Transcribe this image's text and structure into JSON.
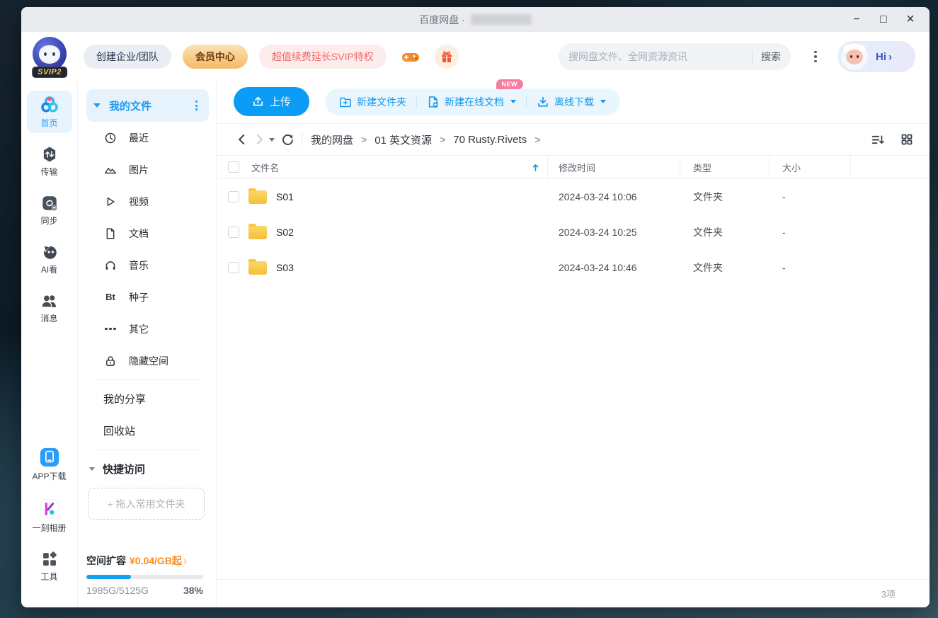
{
  "titlebar": {
    "title": "百度网盘 ·",
    "minimize": "−",
    "maximize": "□",
    "close": "×"
  },
  "header": {
    "logo_badge": "SVIP2",
    "create_team_label": "创建企业/团队",
    "member_center_label": "会员中心",
    "svip_promo_label": "超值续费延长SVIP特权",
    "search_placeholder": "搜网盘文件、全网资源资讯",
    "search_button_label": "搜索",
    "greeting": "Hi",
    "greeting_chevron": "›"
  },
  "rail": {
    "items": [
      {
        "label": "首页",
        "active": true
      },
      {
        "label": "传输",
        "active": false
      },
      {
        "label": "同步",
        "active": false
      },
      {
        "label": "AI看",
        "active": false
      },
      {
        "label": "消息",
        "active": false
      }
    ],
    "bottom_items": [
      {
        "label": "APP下载"
      },
      {
        "label": "一刻相册"
      },
      {
        "label": "工具"
      }
    ]
  },
  "sidebar": {
    "my_files_label": "我的文件",
    "items": [
      {
        "label": "最近"
      },
      {
        "label": "图片"
      },
      {
        "label": "视频"
      },
      {
        "label": "文档"
      },
      {
        "label": "音乐"
      },
      {
        "label": "种子",
        "icon_text": "Bt"
      },
      {
        "label": "其它"
      },
      {
        "label": "隐藏空间"
      }
    ],
    "my_share_label": "我的分享",
    "recycle_label": "回收站",
    "quick_access_label": "快捷访问",
    "drop_zone_hint": "+ 拖入常用文件夹",
    "expand": {
      "label": "空间扩容",
      "price": "¥0.04/GB起",
      "arrow": "›",
      "usage": "1985G/5125G",
      "percent_label": "38%",
      "percent_value": 38
    }
  },
  "toolbar": {
    "upload_label": "上传",
    "new_folder_label": "新建文件夹",
    "new_doc_label": "新建在线文档",
    "new_badge": "NEW",
    "offline_download_label": "离线下载"
  },
  "breadcrumb": {
    "items": [
      "我的网盘",
      "01 英文资源",
      "70 Rusty.Rivets"
    ]
  },
  "table": {
    "headers": {
      "name": "文件名",
      "time": "修改时间",
      "type": "类型",
      "size": "大小"
    },
    "rows": [
      {
        "name": "S01",
        "time": "2024-03-24 10:06",
        "type": "文件夹",
        "size": "-"
      },
      {
        "name": "S02",
        "time": "2024-03-24 10:25",
        "type": "文件夹",
        "size": "-"
      },
      {
        "name": "S03",
        "time": "2024-03-24 10:46",
        "type": "文件夹",
        "size": "-"
      }
    ],
    "footer_count": "3项"
  },
  "colors": {
    "primary_blue": "#0b9cf5",
    "accent_orange": "#ff8c1a",
    "new_badge_pink": "#f87c9f",
    "folder_yellow": "#f6c645"
  }
}
